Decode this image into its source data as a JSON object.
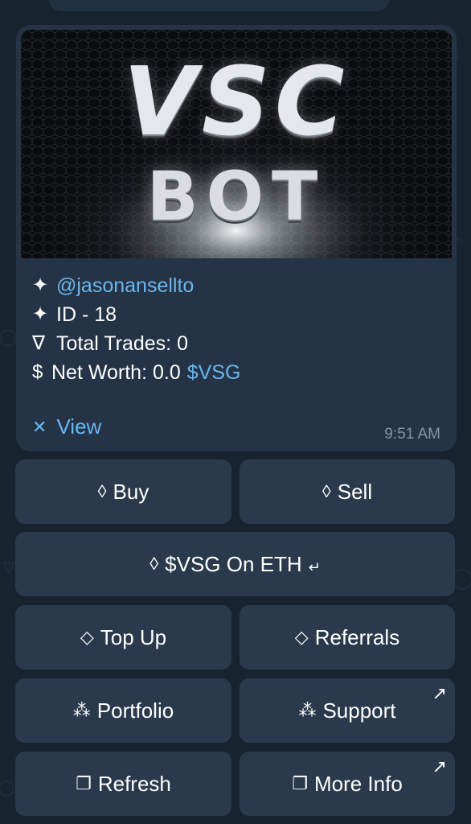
{
  "banner": {
    "logo_top": "VSC",
    "logo_bottom": "BOT"
  },
  "message": {
    "username": "@jasonansellto",
    "id_label": "ID - 18",
    "trades_label": "Total Trades: 0",
    "networth_label": "Net Worth: 0.0",
    "networth_token": "$VSG",
    "bullet_icon": "✦",
    "trades_icon": "∇",
    "dollar_icon": "$",
    "view_label": "View",
    "time": "9:51 AM"
  },
  "keyboard": {
    "buy": {
      "icon": "◊",
      "label": "Buy"
    },
    "sell": {
      "icon": "◊",
      "label": "Sell"
    },
    "vsg_eth": {
      "icon": "◊",
      "label": "$VSG On ETH"
    },
    "top_up": {
      "icon": "◇",
      "label": "Top Up"
    },
    "referrals": {
      "icon": "◇",
      "label": "Referrals"
    },
    "portfolio": {
      "icon": "⁂",
      "label": "Portfolio"
    },
    "support": {
      "icon": "⁂",
      "label": "Support"
    },
    "refresh": {
      "icon": "❐",
      "label": "Refresh"
    },
    "more_info": {
      "icon": "❐",
      "label": "More Info"
    }
  },
  "colors": {
    "background": "#182330",
    "card": "#243345",
    "button": "#2a3a4c",
    "link": "#6ab7f0",
    "muted": "#8496a8"
  }
}
